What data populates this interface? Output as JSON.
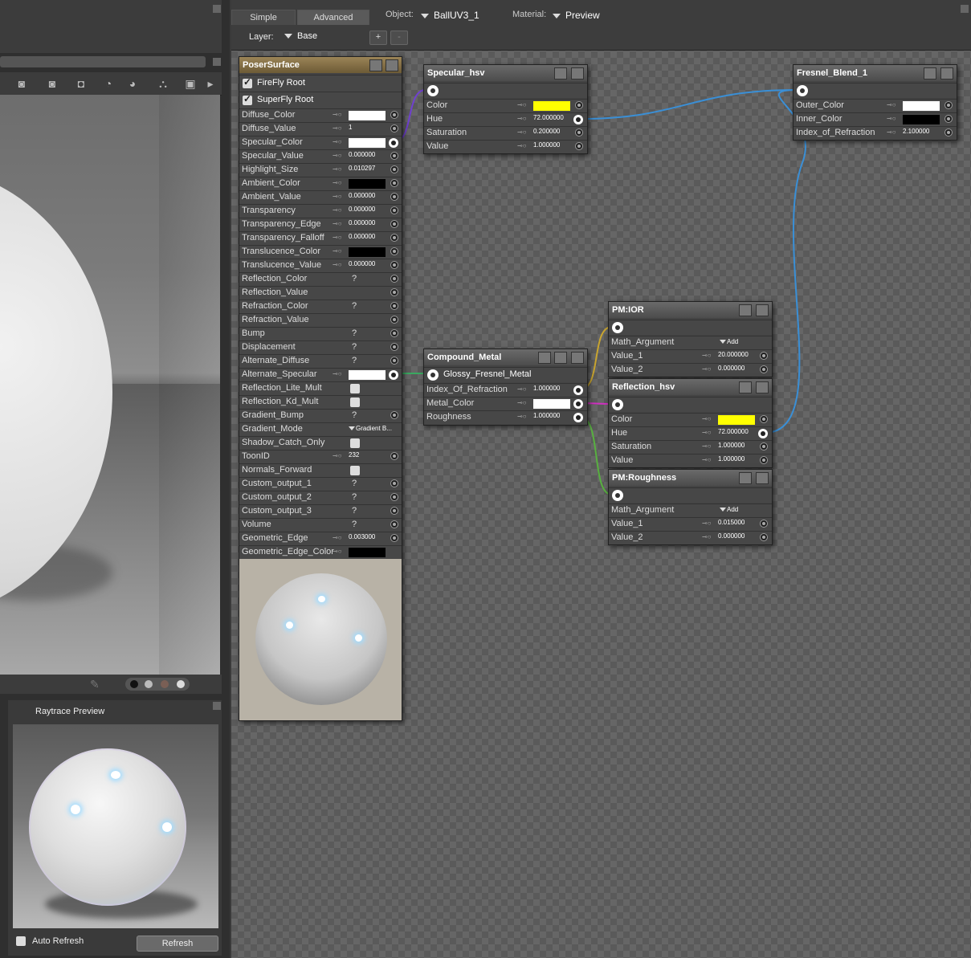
{
  "editor": {
    "tabs": [
      {
        "label": "Simple"
      },
      {
        "label": "Advanced"
      }
    ],
    "object_label": "Object:",
    "object_value": "BallUV3_1",
    "material_label": "Material:",
    "material_value": "Preview",
    "layer_label": "Layer:",
    "layer_value": "Base",
    "add_label": "+",
    "remove_label": "-"
  },
  "raytrace": {
    "title": "Raytrace Preview",
    "auto_refresh": "Auto Refresh",
    "refresh": "Refresh"
  },
  "poser": {
    "title": "PoserSurface",
    "firefly": "FireFly Root",
    "superfly": "SuperFly Root",
    "rows": [
      {
        "label": "Diffuse_Color"
      },
      {
        "label": "Diffuse_Value",
        "value": "1"
      },
      {
        "label": "Specular_Color"
      },
      {
        "label": "Specular_Value",
        "value": "0.000000"
      },
      {
        "label": "Highlight_Size",
        "value": "0.010297"
      },
      {
        "label": "Ambient_Color"
      },
      {
        "label": "Ambient_Value",
        "value": "0.000000"
      },
      {
        "label": "Transparency",
        "value": "0.000000"
      },
      {
        "label": "Transparency_Edge",
        "value": "0.000000"
      },
      {
        "label": "Transparency_Falloff",
        "value": "0.000000"
      },
      {
        "label": "Translucence_Color"
      },
      {
        "label": "Translucence_Value",
        "value": "0.000000"
      },
      {
        "label": "Reflection_Color",
        "value": "?"
      },
      {
        "label": "Reflection_Value"
      },
      {
        "label": "Refraction_Color",
        "value": "?"
      },
      {
        "label": "Refraction_Value"
      },
      {
        "label": "Bump",
        "value": "?"
      },
      {
        "label": "Displacement",
        "value": "?"
      },
      {
        "label": "Alternate_Diffuse",
        "value": "?"
      },
      {
        "label": "Alternate_Specular"
      },
      {
        "label": "Reflection_Lite_Mult"
      },
      {
        "label": "Reflection_Kd_Mult"
      },
      {
        "label": "Gradient_Bump",
        "value": "?"
      },
      {
        "label": "Gradient_Mode",
        "value": "Gradient B..."
      },
      {
        "label": "Shadow_Catch_Only"
      },
      {
        "label": "ToonID",
        "value": "232"
      },
      {
        "label": "Normals_Forward"
      },
      {
        "label": "Custom_output_1",
        "value": "?"
      },
      {
        "label": "Custom_output_2",
        "value": "?"
      },
      {
        "label": "Custom_output_3",
        "value": "?"
      },
      {
        "label": "Volume",
        "value": "?"
      },
      {
        "label": "Geometric_Edge",
        "value": "0.003000"
      },
      {
        "label": "Geometric_Edge_Color"
      }
    ]
  },
  "specular_hsv": {
    "title": "Specular_hsv",
    "rows": [
      {
        "label": "Color"
      },
      {
        "label": "Hue",
        "value": "72.000000"
      },
      {
        "label": "Saturation",
        "value": "0.200000"
      },
      {
        "label": "Value",
        "value": "1.000000"
      }
    ]
  },
  "fresnel": {
    "title": "Fresnel_Blend_1",
    "rows": [
      {
        "label": "Outer_Color"
      },
      {
        "label": "Inner_Color"
      },
      {
        "label": "Index_of_Refraction",
        "value": "2.100000"
      }
    ]
  },
  "compound": {
    "title": "Compound_Metal",
    "output": "Glossy_Fresnel_Metal",
    "rows": [
      {
        "label": "Index_Of_Refraction",
        "value": "1.000000"
      },
      {
        "label": "Metal_Color"
      },
      {
        "label": "Roughness",
        "value": "1.000000"
      }
    ]
  },
  "pm_ior": {
    "title": "PM:IOR",
    "rows": [
      {
        "label": "Math_Argument",
        "value": "Add"
      },
      {
        "label": "Value_1",
        "value": "20.000000"
      },
      {
        "label": "Value_2",
        "value": "0.000000"
      }
    ]
  },
  "reflection_hsv": {
    "title": "Reflection_hsv",
    "rows": [
      {
        "label": "Color"
      },
      {
        "label": "Hue",
        "value": "72.000000"
      },
      {
        "label": "Saturation",
        "value": "1.000000"
      },
      {
        "label": "Value",
        "value": "1.000000"
      }
    ]
  },
  "pm_rough": {
    "title": "PM:Roughness",
    "rows": [
      {
        "label": "Math_Argument",
        "value": "Add"
      },
      {
        "label": "Value_1",
        "value": "0.015000"
      },
      {
        "label": "Value_2",
        "value": "0.000000"
      }
    ]
  },
  "colors": {
    "yellow": "#ffff00",
    "white": "#ffffff",
    "black": "#000000",
    "wire_blue": "#3a8fd6",
    "wire_purple": "#7040d0",
    "wire_green": "#3aa860",
    "wire_magenta": "#d030c0",
    "wire_yellow": "#c9a530",
    "wire_lime": "#58b040"
  }
}
